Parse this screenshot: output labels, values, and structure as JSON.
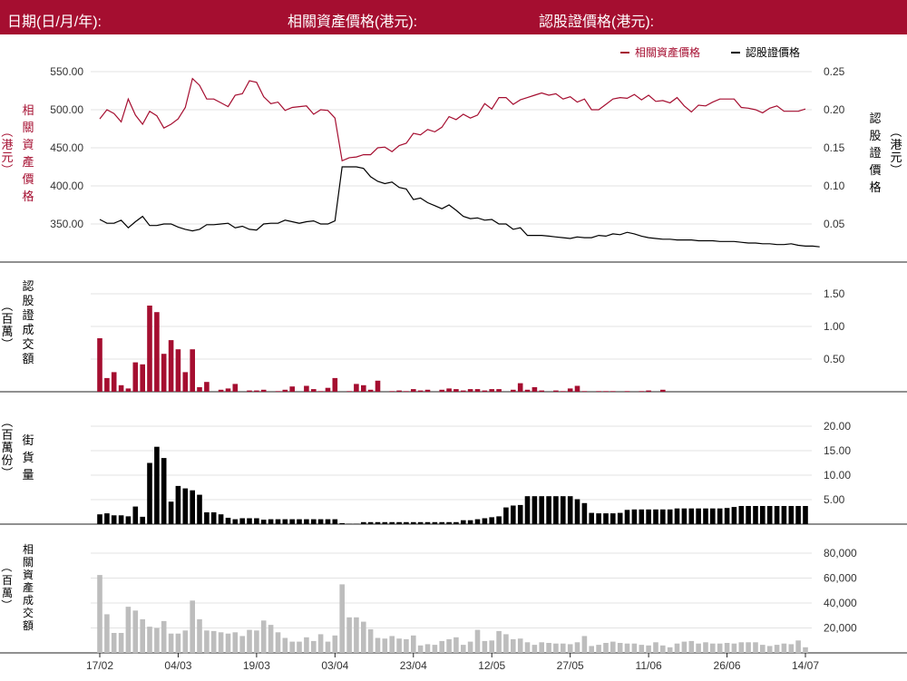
{
  "header": {
    "date_label": "日期(日/月/年):",
    "underlying_label": "相關資產價格(港元):",
    "warrant_label": "認股證價格(港元):"
  },
  "colors": {
    "header_bg": "#a50e30",
    "underlying": "#a50e30",
    "warrant": "#000000",
    "warrant_turnover": "#a50e30",
    "outstanding": "#000000",
    "underlying_turnover": "#bdbdbd",
    "grid": "#e3e3e3"
  },
  "chart_data": [
    {
      "type": "line",
      "legend": [
        "相關資產價格",
        "認股證價格"
      ],
      "legend_position": "top-right",
      "ylabel_left": "相關資產價格（港元）",
      "ylabel_right": "認股證價格（港元）",
      "ylim_left": [
        300,
        560
      ],
      "yticks_left": [
        "550.00",
        "500.00",
        "450.00",
        "400.00",
        "350.00"
      ],
      "ylim_right": [
        0.0,
        0.26
      ],
      "yticks_right": [
        "0.25",
        "0.20",
        "0.15",
        "0.10",
        "0.05"
      ],
      "grid": true,
      "series": [
        {
          "name": "相關資產價格",
          "axis": "left",
          "values": [
            488,
            500,
            495,
            484,
            514,
            493,
            481,
            498,
            492,
            476,
            481,
            488,
            503,
            541,
            532,
            514,
            514,
            509,
            504,
            519,
            521,
            538,
            536,
            517,
            508,
            510,
            499,
            503,
            504,
            505,
            494,
            500,
            499,
            489,
            433,
            437,
            438,
            441,
            441,
            450,
            451,
            445,
            453,
            456,
            469,
            467,
            474,
            471,
            477,
            491,
            487,
            494,
            489,
            493,
            508,
            501,
            516,
            516,
            507,
            513,
            516,
            519,
            522,
            519,
            521,
            514,
            517,
            510,
            514,
            500,
            500,
            507,
            514,
            516,
            515,
            520,
            513,
            519,
            511,
            512,
            509,
            516,
            505,
            497,
            506,
            505,
            510,
            514,
            514,
            514,
            503,
            502,
            500,
            496,
            502,
            505,
            498,
            498,
            498,
            501
          ]
        },
        {
          "name": "認股證價格",
          "axis": "right",
          "values": [
            0.056,
            0.051,
            0.051,
            0.055,
            0.045,
            0.053,
            0.06,
            0.048,
            0.048,
            0.05,
            0.05,
            0.046,
            0.043,
            0.041,
            0.043,
            0.049,
            0.049,
            0.05,
            0.051,
            0.045,
            0.047,
            0.043,
            0.042,
            0.05,
            0.051,
            0.051,
            0.055,
            0.053,
            0.051,
            0.053,
            0.054,
            0.05,
            0.05,
            0.054,
            0.125,
            0.125,
            0.125,
            0.123,
            0.112,
            0.106,
            0.103,
            0.105,
            0.098,
            0.096,
            0.082,
            0.084,
            0.078,
            0.074,
            0.07,
            0.075,
            0.068,
            0.06,
            0.057,
            0.058,
            0.055,
            0.056,
            0.05,
            0.05,
            0.043,
            0.045,
            0.035,
            0.035,
            0.035,
            0.034,
            0.033,
            0.032,
            0.031,
            0.033,
            0.032,
            0.032,
            0.035,
            0.034,
            0.037,
            0.036,
            0.039,
            0.037,
            0.034,
            0.032,
            0.031,
            0.03,
            0.03,
            0.029,
            0.029,
            0.029,
            0.028,
            0.028,
            0.028,
            0.027,
            0.027,
            0.027,
            0.026,
            0.025,
            0.025,
            0.024,
            0.024,
            0.023,
            0.023,
            0.024,
            0.022,
            0.021,
            0.021,
            0.02
          ]
        }
      ]
    },
    {
      "type": "bar",
      "ylabel_left": "認股證成交額（百萬）",
      "ylim": [
        0,
        1.6
      ],
      "yticks": [
        "1.50",
        "1.00",
        "0.50"
      ],
      "series": [
        {
          "name": "認股證成交額",
          "values": [
            0.82,
            0.21,
            0.3,
            0.1,
            0.05,
            0.45,
            0.42,
            1.32,
            1.22,
            0.58,
            0.79,
            0.65,
            0.3,
            0.65,
            0.07,
            0.15,
            0,
            0.03,
            0.05,
            0.12,
            0,
            0.02,
            0.02,
            0.03,
            0,
            0.01,
            0.03,
            0.08,
            0,
            0.09,
            0.04,
            0.01,
            0.06,
            0.21,
            0,
            0.01,
            0.12,
            0.1,
            0.03,
            0.17,
            0,
            0.01,
            0.02,
            0.01,
            0.04,
            0.02,
            0.03,
            0,
            0.03,
            0.05,
            0.04,
            0.02,
            0.04,
            0.04,
            0.02,
            0.04,
            0.04,
            0,
            0.03,
            0.13,
            0.03,
            0.07,
            0.02,
            0,
            0.02,
            0.01,
            0.05,
            0.09,
            0.01,
            0,
            0.01,
            0.01,
            0.01,
            0,
            0.01,
            0,
            0.01,
            0.02,
            0,
            0.03
          ]
        }
      ]
    },
    {
      "type": "bar",
      "ylabel_left": "街貨量（百萬份）",
      "ylim": [
        0,
        21
      ],
      "yticks": [
        "20.00",
        "15.00",
        "10.00",
        "5.00"
      ],
      "series": [
        {
          "name": "街貨量",
          "values": [
            2.0,
            2.2,
            1.8,
            1.8,
            1.6,
            3.6,
            1.5,
            12.5,
            15.8,
            13.5,
            4.6,
            7.8,
            7.3,
            6.9,
            6.0,
            2.4,
            2.4,
            2.0,
            1.3,
            1.0,
            1.2,
            1.2,
            1.2,
            0.9,
            1.0,
            1.0,
            1.0,
            1.0,
            1.0,
            1.0,
            1.0,
            1.0,
            1.0,
            1.0,
            0.2,
            0.1,
            0.1,
            0.4,
            0.4,
            0.4,
            0.4,
            0.4,
            0.4,
            0.4,
            0.4,
            0.4,
            0.4,
            0.4,
            0.4,
            0.4,
            0.4,
            0.8,
            0.8,
            1.0,
            1.2,
            1.4,
            1.6,
            3.4,
            3.8,
            3.9,
            5.7,
            5.7,
            5.7,
            5.7,
            5.7,
            5.7,
            5.7,
            5.1,
            4.3,
            2.3,
            2.2,
            2.2,
            2.2,
            2.3,
            2.9,
            3.0,
            3.0,
            3.0,
            3.0,
            3.0,
            3.0,
            3.2,
            3.2,
            3.2,
            3.2,
            3.2,
            3.2,
            3.2,
            3.3,
            3.5,
            3.7,
            3.7,
            3.7,
            3.7,
            3.7,
            3.7,
            3.7,
            3.7,
            3.7,
            3.7
          ]
        }
      ]
    },
    {
      "type": "bar",
      "ylabel_left": "相關資產成交額（百萬）",
      "ylim": [
        0,
        85000
      ],
      "yticks": [
        "80,000",
        "60,000",
        "40,000",
        "20,000"
      ],
      "categories": [
        "17/02",
        "04/03",
        "19/03",
        "03/04",
        "23/04",
        "12/05",
        "27/05",
        "11/06",
        "26/06",
        "14/07"
      ],
      "series": [
        {
          "name": "相關資產成交額",
          "values": [
            62500,
            31000,
            16000,
            16000,
            37000,
            34000,
            27000,
            21000,
            20000,
            25500,
            15500,
            15500,
            18000,
            42000,
            27000,
            18000,
            17500,
            16500,
            15500,
            16500,
            13500,
            18500,
            18000,
            26000,
            22500,
            16500,
            12000,
            9000,
            9000,
            12500,
            9500,
            15000,
            9000,
            14000,
            55000,
            28500,
            28500,
            25000,
            19000,
            12000,
            11500,
            13500,
            11500,
            11000,
            14000,
            6000,
            7000,
            6500,
            9500,
            11000,
            12500,
            6500,
            9000,
            18500,
            9500,
            10000,
            17500,
            15000,
            11000,
            11500,
            8500,
            6500,
            8500,
            8000,
            7500,
            7500,
            7000,
            8500,
            13500,
            5500,
            6500,
            8000,
            9000,
            8000,
            7500,
            7500,
            6500,
            6000,
            8500,
            6000,
            4500,
            7500,
            9000,
            9500,
            7500,
            8500,
            7500,
            7500,
            8000,
            7500,
            8500,
            8500,
            8500,
            6500,
            5500,
            6500,
            7500,
            7000,
            10000,
            4500
          ]
        }
      ]
    }
  ]
}
